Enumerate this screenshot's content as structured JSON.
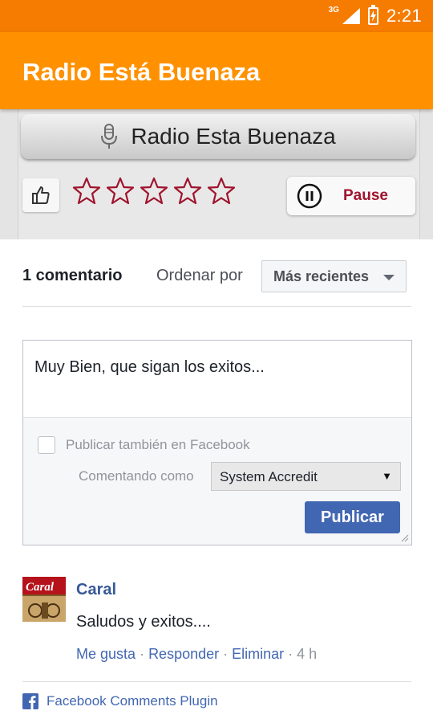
{
  "status_bar": {
    "network": "3G",
    "time": "2:21",
    "signal_icon": "signal-icon",
    "battery_icon": "battery-charging-icon"
  },
  "app_bar": {
    "title": "Radio Está Buenaza",
    "color": "#ff9100"
  },
  "player": {
    "station_name": "Radio Esta Buenaza",
    "station_icon": "microphone-icon",
    "like_icon": "thumbs-up-icon",
    "rating": {
      "max": 5,
      "value": 0,
      "star_color": "#a0142e"
    },
    "pause_label": "Pause",
    "pause_icon": "pause-circle-icon"
  },
  "comments": {
    "count_label": "1 comentario",
    "order_label": "Ordenar por",
    "order_value": "Más recientes",
    "compose": {
      "text": "Muy Bien, que sigan los exitos...",
      "facebook_checkbox_label": "Publicar también en Facebook",
      "commenting_as_label": "Comentando como",
      "account_value": "System Accredit",
      "publish_label": "Publicar"
    },
    "items": [
      {
        "author": "Caral",
        "text": "Saludos y exitos....",
        "actions": [
          "Me gusta",
          "Responder",
          "Eliminar"
        ],
        "time": "4 h",
        "avatar_text": "Caral"
      }
    ],
    "plugin_label": "Facebook Comments Plugin",
    "accent": "#4267b2"
  }
}
